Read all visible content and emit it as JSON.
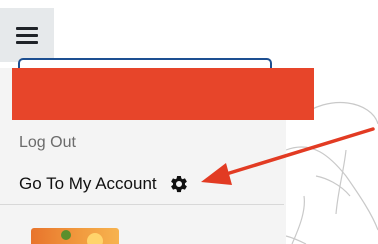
{
  "menu": {
    "toggle_icon": "hamburger-menu-icon",
    "items": [
      {
        "label": "Log Out"
      },
      {
        "label": "Go To My Account",
        "icon": "gear-icon"
      }
    ]
  },
  "annotation": {
    "color": "#e23b23",
    "redaction_color": "#e7452a"
  }
}
